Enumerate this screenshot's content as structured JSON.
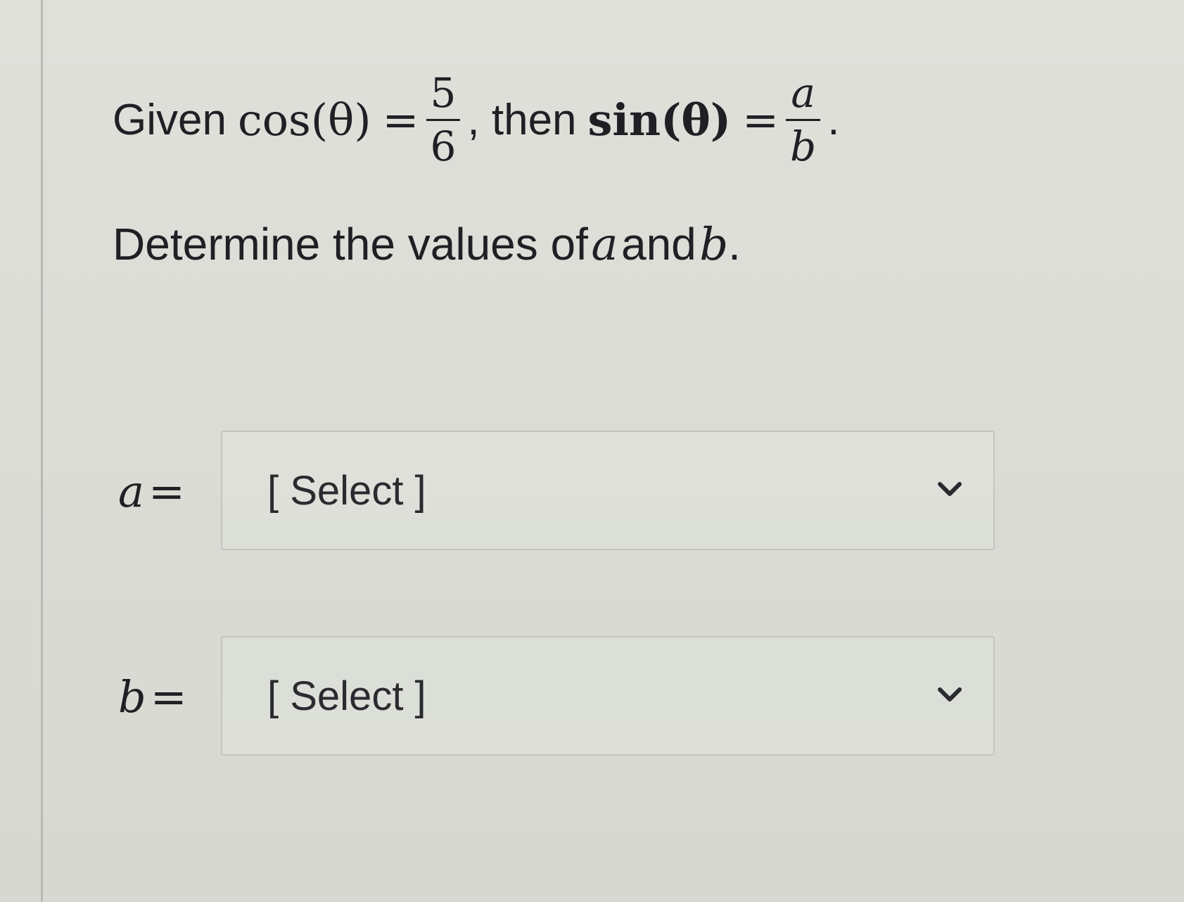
{
  "question": {
    "given_label": "Given",
    "cos_expr": "cos(θ)",
    "equals": "=",
    "cos_num": "5",
    "cos_den": "6",
    "then_label": ", then",
    "sin_expr": "sin(θ)",
    "sin_num": "a",
    "sin_den": "b",
    "period": ".",
    "instruction_prefix": "Determine the values of",
    "var_a": "a",
    "and_label": "and",
    "var_b": "b",
    "instruction_suffix": "."
  },
  "answers": [
    {
      "variable": "a",
      "equals": "=",
      "selected": "[ Select ]",
      "icon": "chevron-down-icon"
    },
    {
      "variable": "b",
      "equals": "=",
      "selected": "[ Select ]",
      "icon": "chevron-down-icon"
    }
  ],
  "colors": {
    "background": "#dcddd6",
    "text": "#1f2024",
    "border": "#c3c6bf"
  }
}
